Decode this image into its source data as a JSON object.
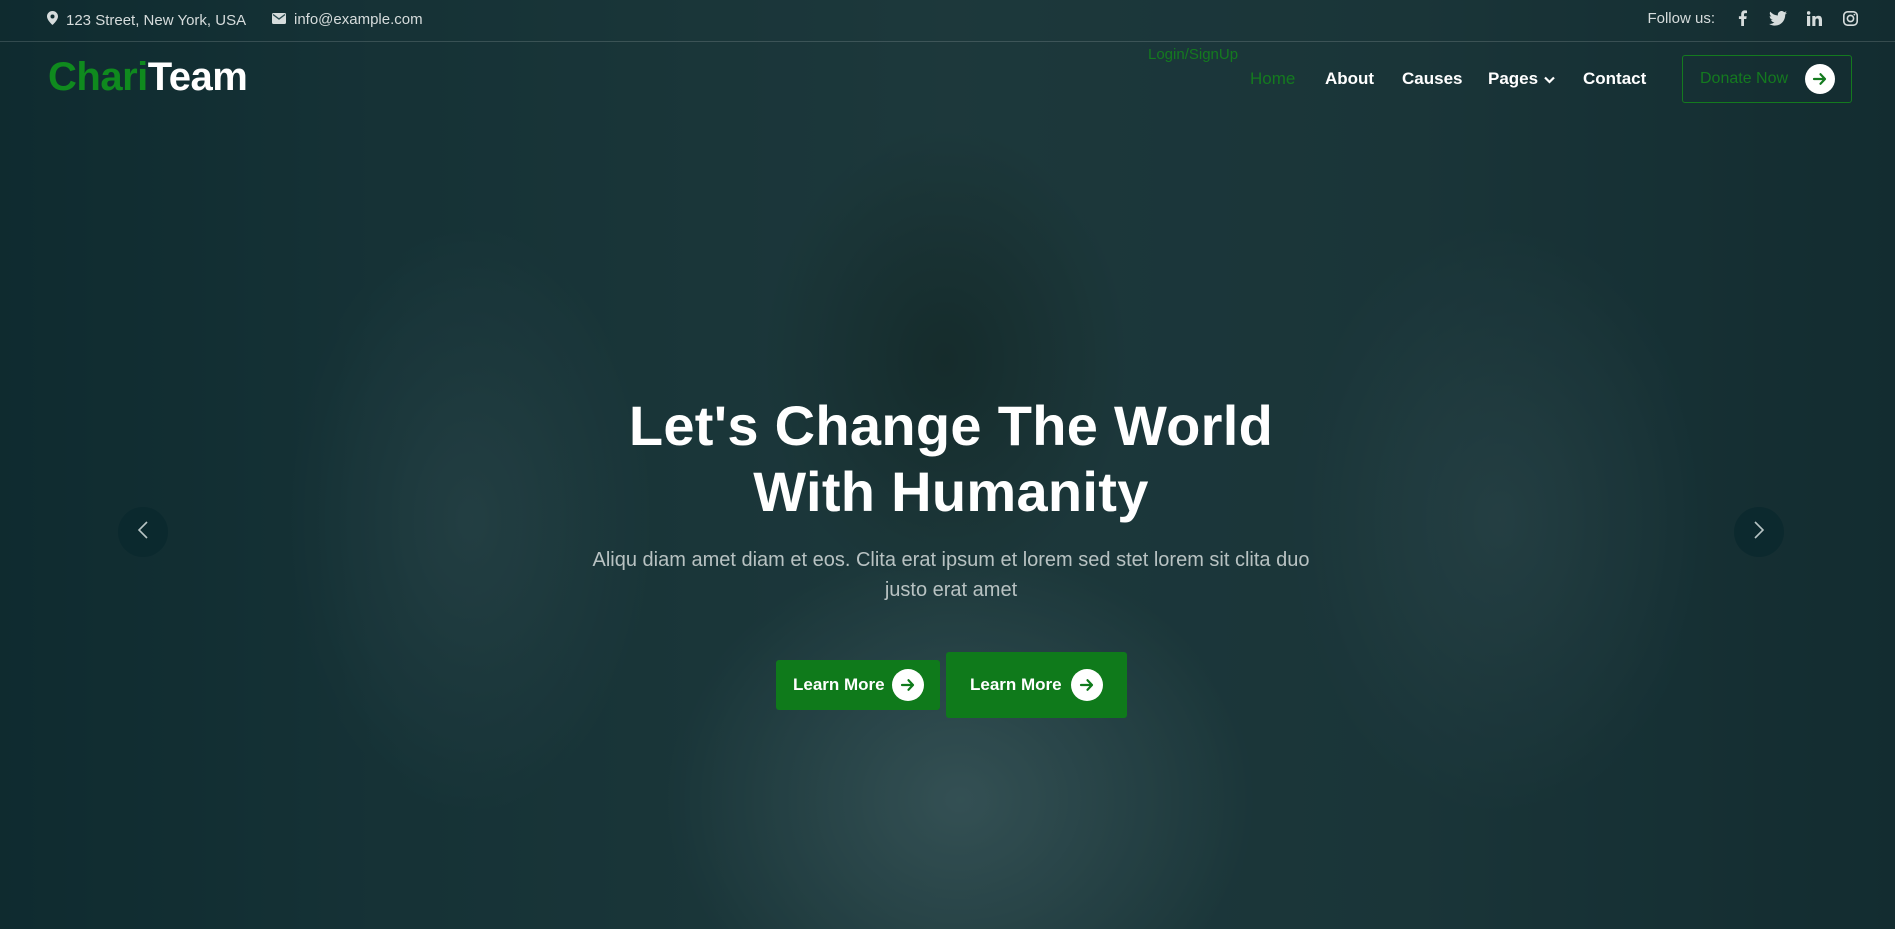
{
  "topbar": {
    "address": "123 Street, New York, USA",
    "email": "info@example.com",
    "follow_label": "Follow us:",
    "social_icons": [
      "facebook-icon",
      "twitter-icon",
      "linkedin-icon",
      "instagram-icon"
    ]
  },
  "brand": {
    "logo_part1": "Chari",
    "logo_part2": "Team",
    "accent_color": "#147a1f"
  },
  "nav": {
    "login_link": "Login/SignUp",
    "items": [
      {
        "label": "Home",
        "active": true
      },
      {
        "label": "About"
      },
      {
        "label": "Causes"
      },
      {
        "label": "Pages",
        "has_dropdown": true
      },
      {
        "label": "Contact"
      }
    ],
    "donate_label": "Donate Now"
  },
  "hero": {
    "title_line1": "Let's Change The World",
    "title_line2": "With Humanity",
    "subtitle": "Aliqu diam amet diam et eos. Clita erat ipsum et lorem sed stet lorem sit clita duo justo erat amet",
    "button1_label": "Learn More",
    "button2_label": "Learn More"
  }
}
